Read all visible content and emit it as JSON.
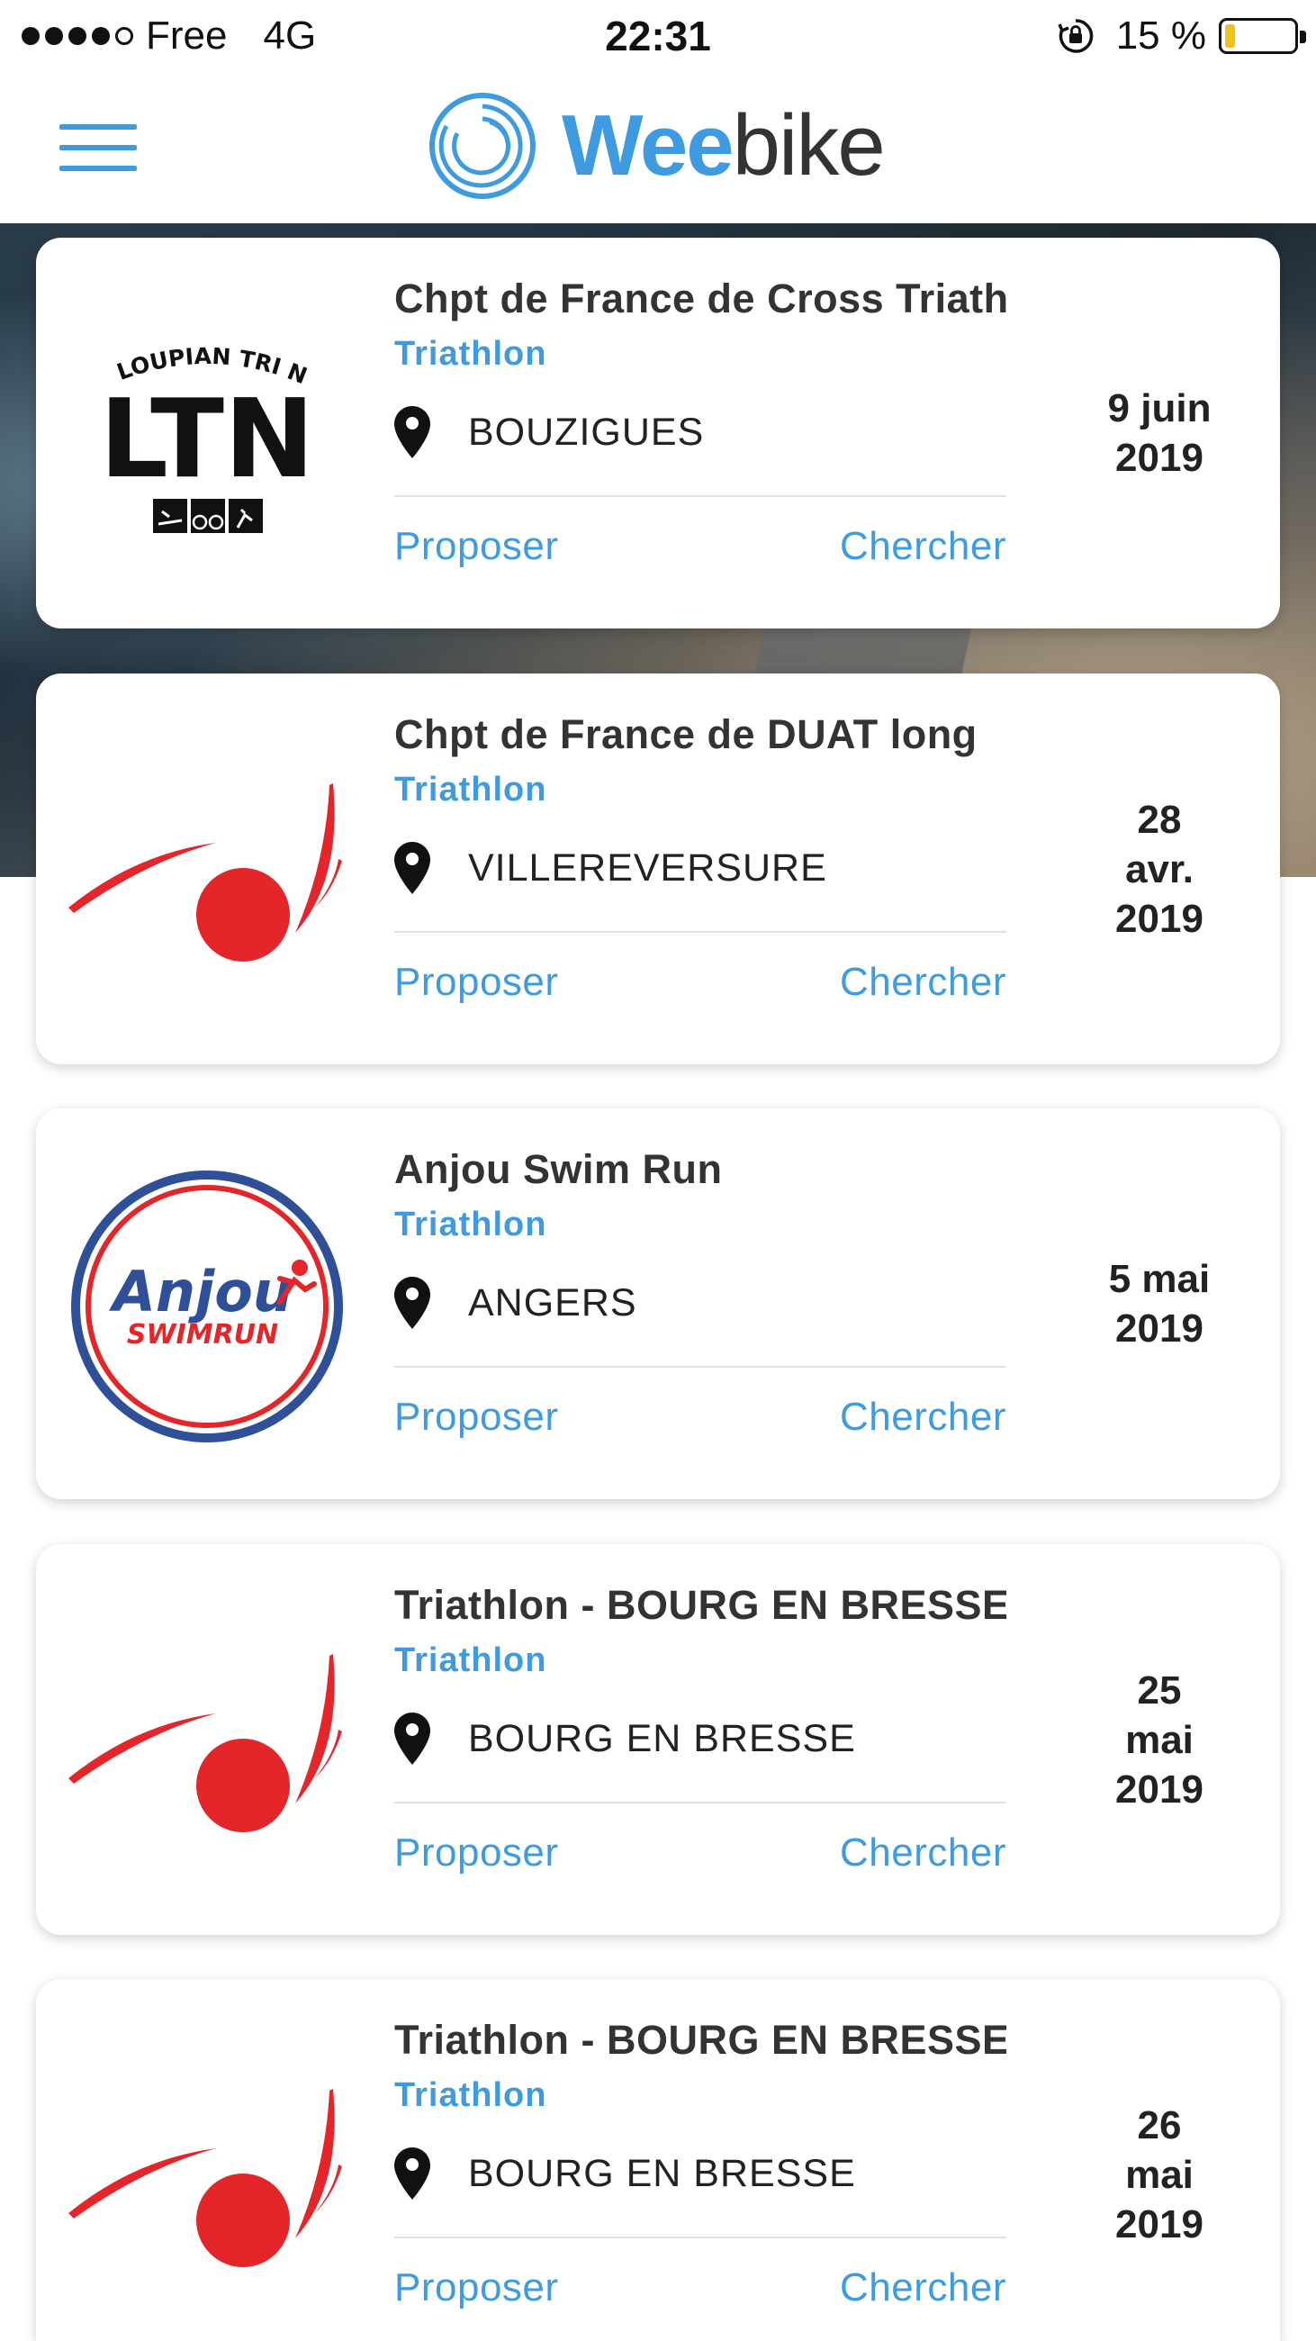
{
  "status_bar": {
    "carrier": "Free",
    "network": "4G",
    "time": "22:31",
    "battery_text": "15 %",
    "battery_level": 0.15,
    "battery_color": "#f3c11b"
  },
  "header": {
    "logo_part1": "Wee",
    "logo_part2": "bike",
    "accent_color": "#3f9be0",
    "menu_icon": "hamburger-menu-icon"
  },
  "events": [
    {
      "logo": "ltn-club-logo",
      "logo_text": [
        "LOUPIAN TRI NATURE",
        "LTN"
      ],
      "title": "Chpt de France de Cross Triathlon",
      "type": "Triathlon",
      "city": "BOUZIGUES",
      "date_lines": [
        "9 juin",
        "2019"
      ],
      "propose": "Proposer",
      "search": "Chercher"
    },
    {
      "logo": "red-swoosh-logo",
      "title": "Chpt de France de DUAT long",
      "type": "Triathlon",
      "city": "VILLEREVERSURE",
      "date_lines": [
        "28",
        "avr.",
        "2019"
      ],
      "propose": "Proposer",
      "search": "Chercher"
    },
    {
      "logo": "anjou-swimrun-logo",
      "logo_text": [
        "Anjou",
        "SWIMRUN"
      ],
      "title": "Anjou Swim Run",
      "type": "Triathlon",
      "city": "ANGERS",
      "date_lines": [
        "5 mai",
        "2019"
      ],
      "propose": "Proposer",
      "search": "Chercher"
    },
    {
      "logo": "red-swoosh-logo",
      "title": "Triathlon - BOURG EN BRESSE",
      "type": "Triathlon",
      "city": "BOURG EN BRESSE",
      "date_lines": [
        "25",
        "mai",
        "2019"
      ],
      "propose": "Proposer",
      "search": "Chercher"
    },
    {
      "logo": "red-swoosh-logo",
      "title": "Triathlon - BOURG EN BRESSE",
      "type": "Triathlon",
      "city": "BOURG EN BRESSE",
      "date_lines": [
        "26",
        "mai",
        "2019"
      ],
      "propose": "Proposer",
      "search": "Chercher"
    }
  ]
}
